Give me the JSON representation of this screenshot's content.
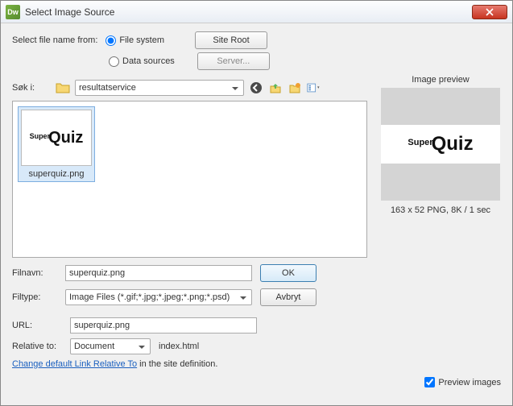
{
  "window": {
    "title": "Select Image Source"
  },
  "source": {
    "label": "Select file name from:",
    "file_system": "File system",
    "data_sources": "Data sources",
    "site_root_btn": "Site Root",
    "server_btn": "Server..."
  },
  "preview": {
    "title": "Image preview",
    "meta": "163 x 52 PNG, 8K / 1 sec"
  },
  "browser": {
    "sok_label": "Søk i:",
    "folder": "resultatservice",
    "selected_file": "superquiz.png"
  },
  "form": {
    "filnavn_label": "Filnavn:",
    "filnavn_value": "superquiz.png",
    "filtype_label": "Filtype:",
    "filtype_value": "Image Files (*.gif;*.jpg;*.jpeg;*.png;*.psd)",
    "ok": "OK",
    "avbryt": "Avbryt"
  },
  "url": {
    "label": "URL:",
    "value": "superquiz.png",
    "relative_label": "Relative to:",
    "relative_value": "Document",
    "relative_file": "index.html",
    "change_link": "Change default Link Relative To",
    "change_suffix": " in the site definition."
  },
  "footer": {
    "preview_images": "Preview images"
  }
}
